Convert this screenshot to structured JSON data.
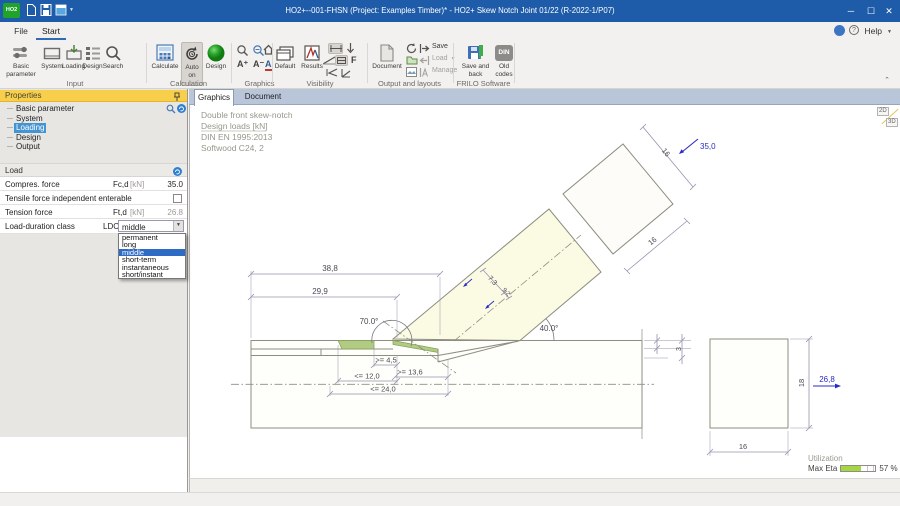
{
  "titlebar": {
    "title": "HO2+--001-FHSN (Project: Examples Timber)* - HO2+ Skew Notch Joint 01/22 (R-2022-1/P07)"
  },
  "menubar": {
    "file": "File",
    "start": "Start",
    "help": "Help"
  },
  "ribbon": {
    "input": {
      "label": "Input",
      "basic": "Basic parameter",
      "system": "System",
      "loading": "Loading",
      "design": "Design",
      "search": "Search"
    },
    "calculation": {
      "label": "Calculation",
      "calculate": "Calculate",
      "auto": "Auto on",
      "design": "Design"
    },
    "graphics": {
      "label": "Graphics"
    },
    "visibility": {
      "label": "Visibility",
      "default": "Default",
      "results": "Results",
      "f": "F"
    },
    "output": {
      "label": "Output and layouts",
      "document": "Document",
      "save": "Save",
      "load": "Load",
      "manage": "Manage"
    },
    "frilo": {
      "label": "FRILO Software",
      "saveback": "Save and back",
      "oldcodes": "Old codes",
      "din": "DIN"
    }
  },
  "sidebar": {
    "header": "Properties",
    "tree": {
      "items": [
        "Basic parameter",
        "System",
        "Loading",
        "Design",
        "Output"
      ]
    },
    "load": {
      "title": "Load",
      "rows": [
        {
          "label": "Compres. force",
          "symbol": "Fc,d",
          "unit": "[kN]",
          "value": "35.0"
        },
        {
          "label": "Tensile force independent enterable"
        },
        {
          "label": "Tension force",
          "symbol": "Ft,d",
          "unit": "[kN]",
          "value": "26.8"
        },
        {
          "label": "Load-duration class",
          "symbol": "LDC",
          "value": "middle"
        }
      ],
      "dropdown": {
        "options": [
          "permanent",
          "long",
          "middle",
          "short-term",
          "instantaneous",
          "short/instant"
        ],
        "selected": "middle"
      }
    }
  },
  "main": {
    "tabs": {
      "graphics": "Graphics",
      "document": "Document"
    },
    "notes": [
      "Double front skew-notch",
      "Design loads [kN]",
      "DIN EN 1995:2013",
      "Softwood C24, 2"
    ],
    "view_toggle": {
      "d2": "2D",
      "d3": "3D"
    },
    "drawing": {
      "dim_beam_end": "38,8",
      "dim_notch": "29,9",
      "angle_front": "70.0°",
      "angle_strut": "40.0°",
      "front_depth": ">= 4,5",
      "front_length": "<= 12,0",
      "heel_length": ">= 13,6",
      "total_length": "<= 24,0",
      "strut_offset": "7,3",
      "strut_offset2": "9,2",
      "end_depth": "3",
      "strut_side_top": "16",
      "strut_side_bottom": "16",
      "beam_width": "16",
      "beam_height": "18",
      "compression": "35,0",
      "tension": "26,8"
    },
    "utilization": {
      "title": "Utilization",
      "metric": "Max Eta",
      "value": "57 %",
      "percent": 57
    }
  }
}
